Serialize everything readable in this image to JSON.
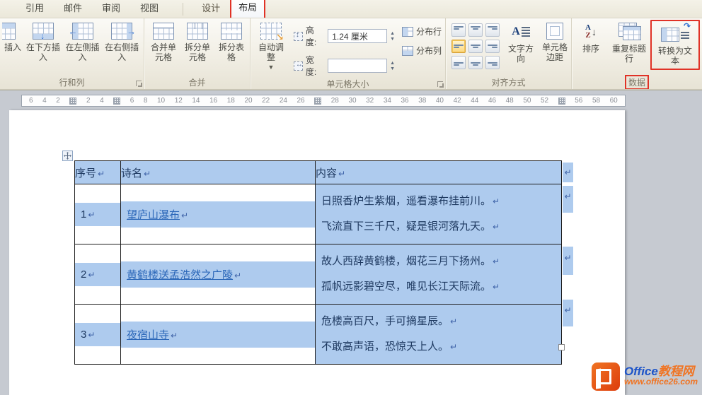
{
  "tabs": {
    "items": [
      {
        "label": "引用"
      },
      {
        "label": "邮件"
      },
      {
        "label": "审阅"
      },
      {
        "label": "视图"
      },
      {
        "label": "设计"
      },
      {
        "label": "布局",
        "active": true,
        "annotated": true
      }
    ]
  },
  "ribbon": {
    "row_col_group": {
      "label": "行和列",
      "insert_partial": "插入",
      "insert_below": "在下方插入",
      "insert_left": "在左侧插入",
      "insert_right": "在右侧插入"
    },
    "merge_group": {
      "label": "合并",
      "merge_cells": "合并单元格",
      "split_cells": "拆分单元格",
      "split_table": "拆分表格"
    },
    "cell_size_group": {
      "label": "单元格大小",
      "autofit": "自动调整",
      "height_label": "高度:",
      "height_value": "1.24 厘米",
      "width_label": "宽度:",
      "width_value": "",
      "distribute_rows": "分布行",
      "distribute_cols": "分布列"
    },
    "alignment_group": {
      "label": "对齐方式",
      "text_direction": "文字方向",
      "cell_margins": "单元格边距"
    },
    "data_group": {
      "label": "数据",
      "sort": "排序",
      "sort_icon_top": "A",
      "sort_icon_bottom": "Z",
      "repeat_header_rows": "重复标题行",
      "convert_to_text": "转换为文本"
    }
  },
  "ruler": {
    "items": [
      "6",
      "4",
      "2",
      "#",
      "2",
      "4",
      "#",
      "6",
      "8",
      "10",
      "12",
      "14",
      "16",
      "18",
      "20",
      "22",
      "24",
      "26",
      "#",
      "28",
      "30",
      "32",
      "34",
      "36",
      "38",
      "40",
      "42",
      "44",
      "46",
      "48",
      "50",
      "52",
      "#",
      "56",
      "58",
      "60"
    ]
  },
  "table": {
    "headers": [
      {
        "label": "序号"
      },
      {
        "label": "诗名"
      },
      {
        "label": "内容"
      }
    ],
    "rows": [
      {
        "no": "1",
        "title": "望庐山瀑布",
        "line1": "日照香炉生紫烟，遥看瀑布挂前川。",
        "line2": "飞流直下三千尺，疑是银河落九天。"
      },
      {
        "no": "2",
        "title": "黄鹤楼送孟浩然之广陵",
        "line1": "故人西辞黄鹤楼，烟花三月下扬州。",
        "line2": "孤帆远影碧空尽，唯见长江天际流。"
      },
      {
        "no": "3",
        "title": "夜宿山寺",
        "line1": "危楼高百尺，手可摘星辰。",
        "line2": "不敢高声语，恐惊天上人。"
      }
    ],
    "mark": "↵"
  },
  "watermark": {
    "brand_office": "Office",
    "brand_suffix": "教程网",
    "url": "www.office26.com"
  },
  "colors": {
    "selection_blue": "#aecbee",
    "annotation_red": "#e03226",
    "link_blue": "#2a66b8",
    "accent_orange": "#f07423"
  }
}
